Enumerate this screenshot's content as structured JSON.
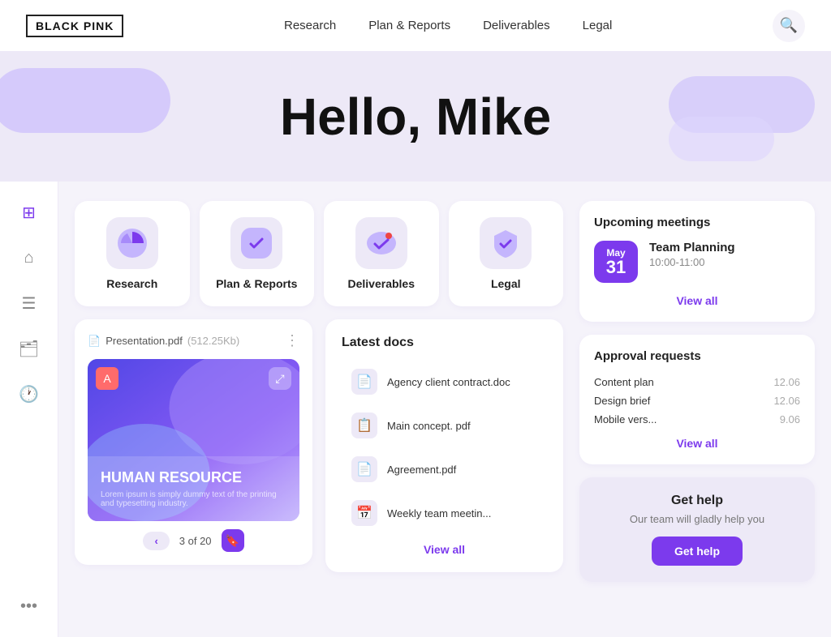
{
  "brand": {
    "name": "BLACK PINK"
  },
  "nav": {
    "links": [
      {
        "id": "research",
        "label": "Research"
      },
      {
        "id": "plan-reports",
        "label": "Plan & Reports"
      },
      {
        "id": "deliverables",
        "label": "Deliverables"
      },
      {
        "id": "legal",
        "label": "Legal"
      }
    ]
  },
  "hero": {
    "greeting": "Hello, Mike"
  },
  "categories": [
    {
      "id": "research",
      "label": "Research",
      "icon": "📊"
    },
    {
      "id": "plan-reports",
      "label": "Plan & Reports",
      "icon": "✅"
    },
    {
      "id": "deliverables",
      "label": "Deliverables",
      "icon": "✔️"
    },
    {
      "id": "legal",
      "label": "Legal",
      "icon": "🛡️"
    }
  ],
  "file_preview": {
    "name": "Presentation.pdf",
    "size": "(512.25Kb)",
    "page": "3 of 20",
    "title": "HUMAN RESOURCE",
    "subtitle": "Lorem ipsum is simply dummy text of the printing and typesetting industry."
  },
  "latest_docs": {
    "title": "Latest docs",
    "view_all": "View all",
    "items": [
      {
        "name": "Agency client contract.doc",
        "icon": "📄"
      },
      {
        "name": "Main concept. pdf",
        "icon": "📋"
      },
      {
        "name": "Agreement.pdf",
        "icon": "📄"
      },
      {
        "name": "Weekly team meetin...",
        "icon": "📅"
      }
    ]
  },
  "meetings": {
    "title": "Upcoming meetings",
    "view_all": "View all",
    "items": [
      {
        "month": "May",
        "day": "31",
        "name": "Team Planning",
        "time": "10:00-11:00"
      }
    ]
  },
  "approvals": {
    "title": "Approval requests",
    "view_all": "View all",
    "items": [
      {
        "name": "Content plan",
        "time": "12.06"
      },
      {
        "name": "Design brief",
        "time": "12.06"
      },
      {
        "name": "Mobile vers...",
        "time": "9.06"
      }
    ]
  },
  "help": {
    "title": "Get help",
    "subtitle": "Our team will gladly help you",
    "button": "Get help"
  },
  "sidebar": {
    "icons": [
      {
        "id": "dashboard",
        "symbol": "⊞"
      },
      {
        "id": "home",
        "symbol": "⌂"
      },
      {
        "id": "list",
        "symbol": "≡"
      },
      {
        "id": "folder",
        "symbol": "📁"
      },
      {
        "id": "clock",
        "symbol": "🕐"
      },
      {
        "id": "more",
        "symbol": "…"
      }
    ]
  }
}
